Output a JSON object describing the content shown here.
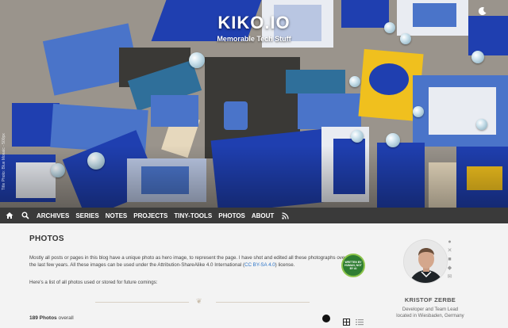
{
  "brand": {
    "title": "KIKO.IO",
    "subtitle": "Memorable Tech Stuff"
  },
  "hero": {
    "credit": "Title Photo: Blue Mosaic - 500px"
  },
  "nav": {
    "items": [
      {
        "label": "ARCHIVES"
      },
      {
        "label": "SERIES"
      },
      {
        "label": "NOTES"
      },
      {
        "label": "PROJECTS"
      },
      {
        "label": "TINY-TOOLS"
      },
      {
        "label": "PHOTOS"
      },
      {
        "label": "ABOUT"
      }
    ],
    "icons": [
      "home-icon",
      "search-icon",
      "rss-icon"
    ]
  },
  "page": {
    "title": "PHOTOS",
    "intro_before": "Mostly all posts or pages in this blog have a unique photo as hero image, to represent the page. I have shot and edited all these photographs over the last few years. All these images can be used under the Attribution-ShareAlike 4.0 International (",
    "intro_link": "CC BY-SA 4.0",
    "intro_after": ") license.",
    "list_intro": "Here's a list of all photos used or stored for future comings:",
    "count_number": "189 Photos",
    "count_suffix": " overall",
    "badge_text": "WRITTEN BY HUMAN, NOT BY AI"
  },
  "author": {
    "name": "KRISTOF ZERBE",
    "role": "Developer and Team Lead",
    "location": "located in Wiesbaden, Germany",
    "social_icons": [
      "github-icon",
      "twitter-icon",
      "linkedin-icon",
      "mastodon-icon",
      "email-icon"
    ]
  },
  "colors": {
    "nav_bg": "#3a3a3a",
    "link": "#2a73c8",
    "badge": "#2e7d32"
  }
}
